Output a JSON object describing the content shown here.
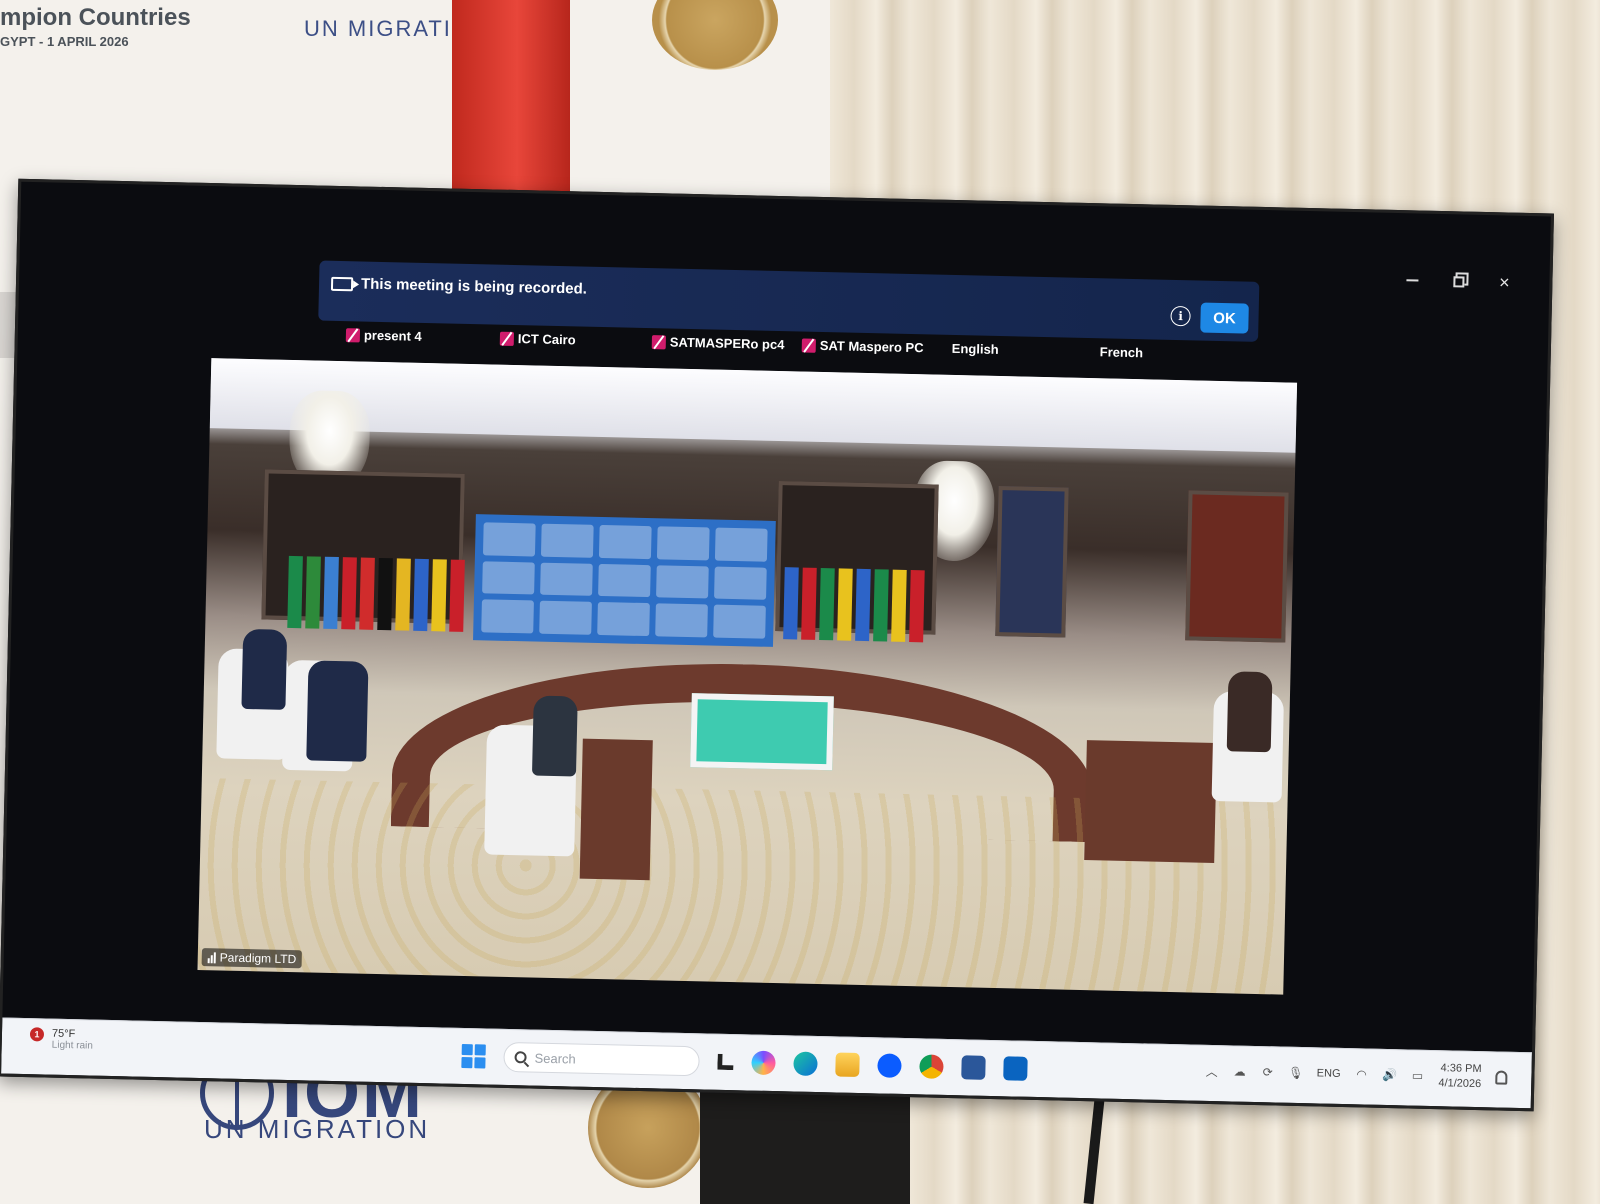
{
  "room": {
    "banner_title": "mpion Countries",
    "banner_date": "GYPT - 1 APRIL 2026",
    "banner_org_top": "UN MIGRATIC",
    "logo_text": "IOM",
    "logo_subtitle": "UN MIGRATION"
  },
  "meeting": {
    "recording_notice": "This meeting is being recorded.",
    "ok_label": "OK",
    "info_glyph": "i",
    "participants": [
      {
        "name": "present 4",
        "muted": true
      },
      {
        "name": "ICT Cairo",
        "muted": true
      },
      {
        "name": "SATMASPERo pc4",
        "muted": true
      },
      {
        "name": "SAT Maspero PC",
        "muted": true
      },
      {
        "name": "English",
        "muted": false
      },
      {
        "name": "French",
        "muted": false
      }
    ],
    "active_tile_label": "Paradigm LTD",
    "window_controls": {
      "minimize": "minimize-icon",
      "restore": "restore-icon",
      "close": "×"
    }
  },
  "taskbar": {
    "weather_alert": "1",
    "temperature": "75°F",
    "condition": "Light rain",
    "search_placeholder": "Search",
    "language": "ENG",
    "time": "4:36 PM",
    "date": "4/1/2026",
    "pinned_apps": [
      "file-icon",
      "copilot-icon",
      "edge-icon",
      "explorer-icon",
      "zoom-icon",
      "chrome-icon",
      "word-icon",
      "outlook-icon"
    ],
    "tray_icons": [
      "chevron-up-icon",
      "onedrive-icon",
      "sync-icon",
      "microphone-icon",
      "wifi-icon",
      "volume-icon",
      "battery-icon"
    ]
  },
  "colors": {
    "recording_bar": "#1b2d5a",
    "ok_button": "#1e88e5",
    "mute_badge": "#d01c6c",
    "taskbar": "#f2f4f8"
  }
}
